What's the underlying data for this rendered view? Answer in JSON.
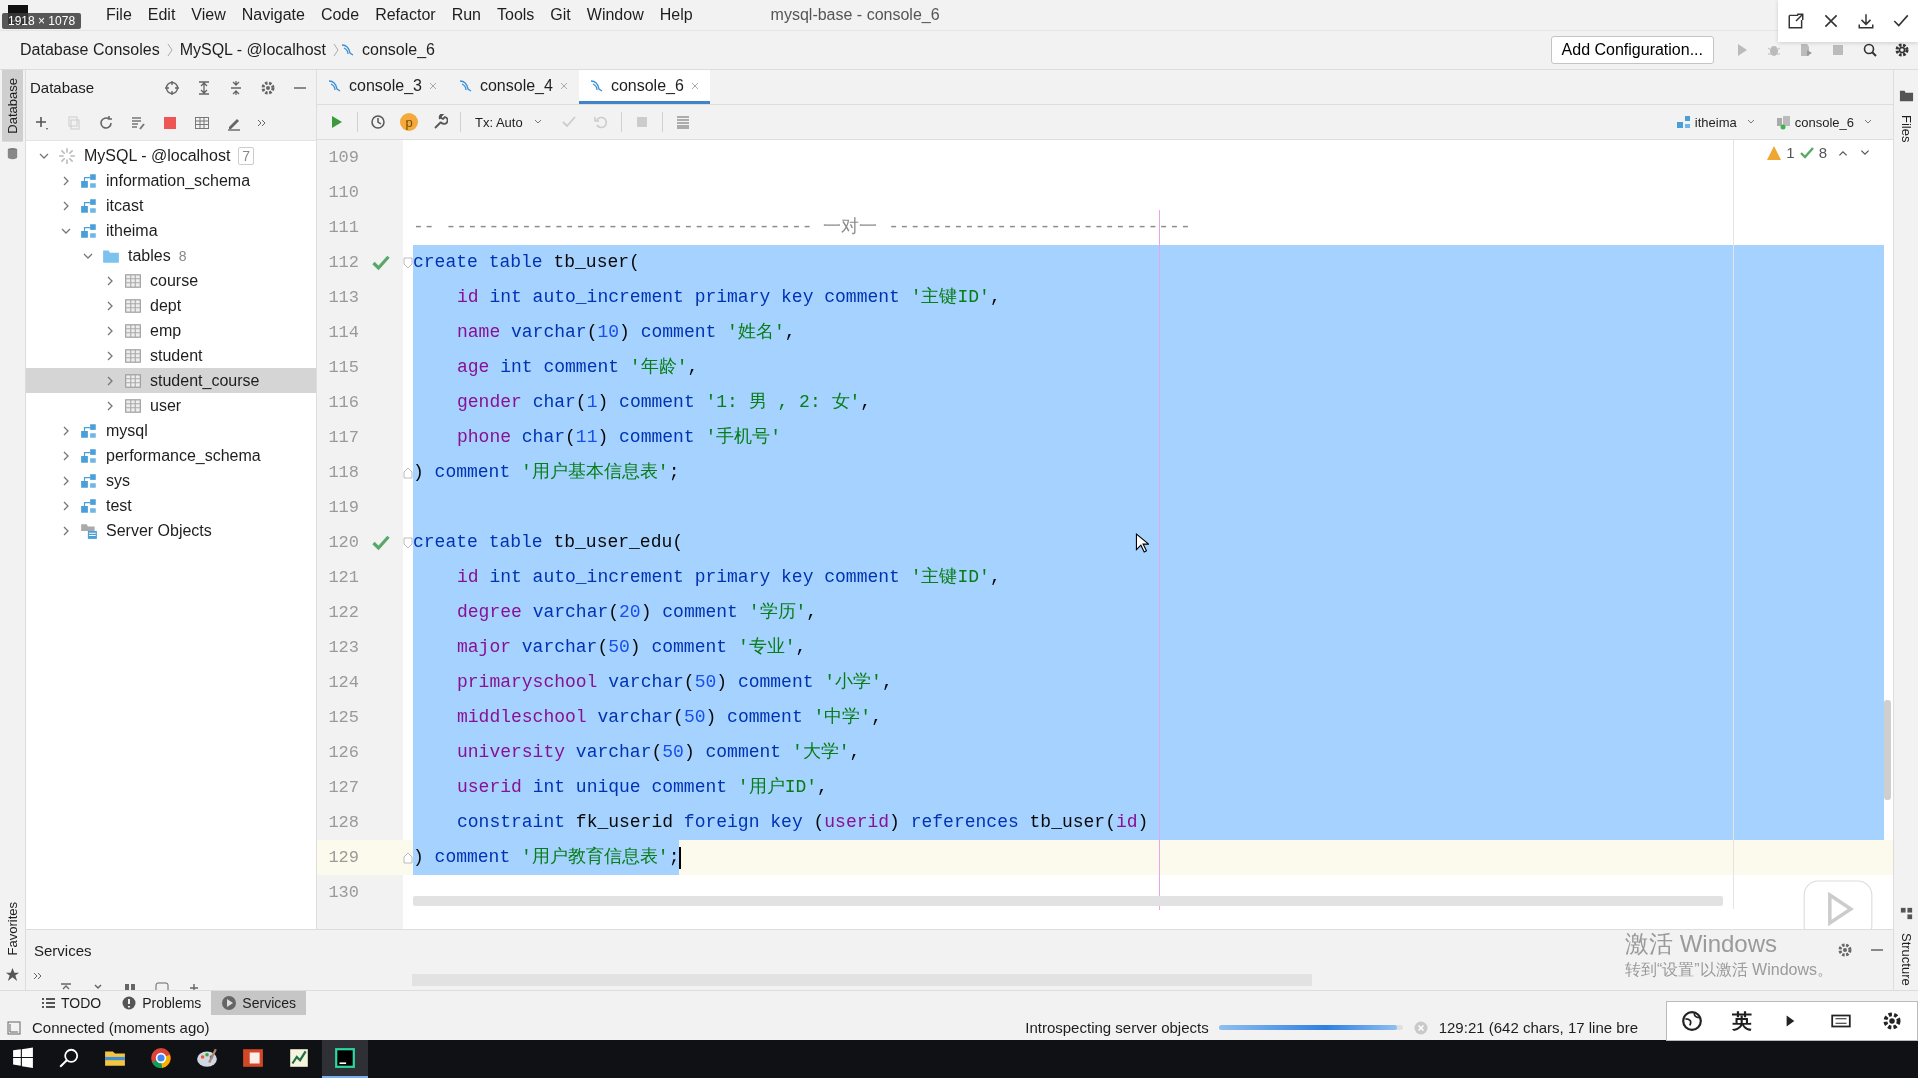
{
  "screen_size_label": "1918 × 1078",
  "menu": [
    "File",
    "Edit",
    "View",
    "Navigate",
    "Code",
    "Refactor",
    "Run",
    "Tools",
    "Git",
    "Window",
    "Help"
  ],
  "window_title": "mysql-base - console_6",
  "breadcrumbs": [
    {
      "label": "Database Consoles",
      "kind": "text"
    },
    {
      "label": "MySQL - @localhost",
      "kind": "text"
    },
    {
      "label": "console_6",
      "kind": "console"
    }
  ],
  "run_config": {
    "label": "Add Configuration..."
  },
  "side_tabs": {
    "left_top": "Database",
    "left_bottom": "Favorites",
    "right_top": "Files",
    "right_bottom": "Structure"
  },
  "database_panel": {
    "title": "Database"
  },
  "tree": [
    {
      "label": "MySQL - @localhost",
      "kind": "host",
      "count": "7",
      "expanded": true,
      "selected": false,
      "children": [
        {
          "label": "information_schema",
          "kind": "schema",
          "expanded": false,
          "selected": false
        },
        {
          "label": "itcast",
          "kind": "schema",
          "expanded": false,
          "selected": false
        },
        {
          "label": "itheima",
          "kind": "schema",
          "expanded": true,
          "selected": false,
          "children": [
            {
              "label": "tables",
              "kind": "folder",
              "count": "8",
              "expanded": true,
              "selected": false,
              "children": [
                {
                  "label": "course",
                  "kind": "table",
                  "expanded": false,
                  "selected": false
                },
                {
                  "label": "dept",
                  "kind": "table",
                  "expanded": false,
                  "selected": false
                },
                {
                  "label": "emp",
                  "kind": "table",
                  "expanded": false,
                  "selected": false
                },
                {
                  "label": "student",
                  "kind": "table",
                  "expanded": false,
                  "selected": false
                },
                {
                  "label": "student_course",
                  "kind": "table",
                  "expanded": false,
                  "selected": true
                },
                {
                  "label": "user",
                  "kind": "table",
                  "expanded": false,
                  "selected": false
                }
              ]
            }
          ]
        },
        {
          "label": "mysql",
          "kind": "schema",
          "expanded": false,
          "selected": false
        },
        {
          "label": "performance_schema",
          "kind": "schema",
          "expanded": false,
          "selected": false
        },
        {
          "label": "sys",
          "kind": "schema",
          "expanded": false,
          "selected": false
        },
        {
          "label": "test",
          "kind": "schema",
          "expanded": false,
          "selected": false
        },
        {
          "label": "Server Objects",
          "kind": "server",
          "expanded": false,
          "selected": false
        }
      ]
    }
  ],
  "editor_tabs": [
    {
      "label": "console_3",
      "selected": false
    },
    {
      "label": "console_4",
      "selected": false
    },
    {
      "label": "console_6",
      "selected": true
    }
  ],
  "profile_badge": "p",
  "tx_mode": "Tx: Auto",
  "schema_selector": "itheima",
  "session_selector": "console_6",
  "inspections": {
    "warnings": "1",
    "checks": "8"
  },
  "code_lines": [
    {
      "number": "109"
    },
    {
      "number": "110"
    },
    {
      "number": "111",
      "tokens": [
        {
          "t": "-- ---------------------------------- 一对一 ----------------------------",
          "kind": "comment"
        }
      ]
    },
    {
      "number": "112",
      "check": true,
      "fold_start": true,
      "selected": true,
      "tokens": [
        {
          "t": "create ",
          "kind": "keyword"
        },
        {
          "t": "table ",
          "kind": "keyword"
        },
        {
          "t": "tb_user(",
          "kind": "plain"
        }
      ]
    },
    {
      "number": "113",
      "indent": true,
      "selected": true,
      "tokens": [
        {
          "t": "id ",
          "kind": "field"
        },
        {
          "t": "int auto_increment primary key comment ",
          "kind": "keyword"
        },
        {
          "t": "'主键ID'",
          "kind": "string"
        },
        {
          "t": ",",
          "kind": "plain"
        }
      ]
    },
    {
      "number": "114",
      "indent": true,
      "selected": true,
      "tokens": [
        {
          "t": "name ",
          "kind": "field"
        },
        {
          "t": "varchar",
          "kind": "keyword"
        },
        {
          "t": "(",
          "kind": "plain"
        },
        {
          "t": "10",
          "kind": "number"
        },
        {
          "t": ") ",
          "kind": "plain"
        },
        {
          "t": "comment ",
          "kind": "keyword"
        },
        {
          "t": "'姓名'",
          "kind": "string"
        },
        {
          "t": ",",
          "kind": "plain"
        }
      ]
    },
    {
      "number": "115",
      "indent": true,
      "selected": true,
      "tokens": [
        {
          "t": "age ",
          "kind": "field"
        },
        {
          "t": "int comment ",
          "kind": "keyword"
        },
        {
          "t": "'年龄'",
          "kind": "string"
        },
        {
          "t": ",",
          "kind": "plain"
        }
      ]
    },
    {
      "number": "116",
      "indent": true,
      "selected": true,
      "tokens": [
        {
          "t": "gender ",
          "kind": "field"
        },
        {
          "t": "char",
          "kind": "keyword"
        },
        {
          "t": "(",
          "kind": "plain"
        },
        {
          "t": "1",
          "kind": "number"
        },
        {
          "t": ") ",
          "kind": "plain"
        },
        {
          "t": "comment ",
          "kind": "keyword"
        },
        {
          "t": "'1: 男 , 2: 女'",
          "kind": "string"
        },
        {
          "t": ",",
          "kind": "plain"
        }
      ]
    },
    {
      "number": "117",
      "indent": true,
      "selected": true,
      "tokens": [
        {
          "t": "phone ",
          "kind": "field"
        },
        {
          "t": "char",
          "kind": "keyword"
        },
        {
          "t": "(",
          "kind": "plain"
        },
        {
          "t": "11",
          "kind": "number"
        },
        {
          "t": ") ",
          "kind": "plain"
        },
        {
          "t": "comment ",
          "kind": "keyword"
        },
        {
          "t": "'手机号'",
          "kind": "string"
        }
      ]
    },
    {
      "number": "118",
      "fold_end": true,
      "selected": true,
      "tokens": [
        {
          "t": ") ",
          "kind": "plain"
        },
        {
          "t": "comment ",
          "kind": "keyword"
        },
        {
          "t": "'用户基本信息表'",
          "kind": "string"
        },
        {
          "t": ";",
          "kind": "plain"
        }
      ]
    },
    {
      "number": "119",
      "selected": true
    },
    {
      "number": "120",
      "check": true,
      "fold_start": true,
      "selected": true,
      "tokens": [
        {
          "t": "create ",
          "kind": "keyword"
        },
        {
          "t": "table ",
          "kind": "keyword"
        },
        {
          "t": "tb_user_edu(",
          "kind": "plain"
        }
      ]
    },
    {
      "number": "121",
      "indent": true,
      "selected": true,
      "tokens": [
        {
          "t": "id ",
          "kind": "field"
        },
        {
          "t": "int auto_increment primary key comment ",
          "kind": "keyword"
        },
        {
          "t": "'主键ID'",
          "kind": "string"
        },
        {
          "t": ",",
          "kind": "plain"
        }
      ]
    },
    {
      "number": "122",
      "indent": true,
      "selected": true,
      "tokens": [
        {
          "t": "degree ",
          "kind": "field"
        },
        {
          "t": "varchar",
          "kind": "keyword"
        },
        {
          "t": "(",
          "kind": "plain"
        },
        {
          "t": "20",
          "kind": "number"
        },
        {
          "t": ") ",
          "kind": "plain"
        },
        {
          "t": "comment ",
          "kind": "keyword"
        },
        {
          "t": "'学历'",
          "kind": "string"
        },
        {
          "t": ",",
          "kind": "plain"
        }
      ]
    },
    {
      "number": "123",
      "indent": true,
      "selected": true,
      "tokens": [
        {
          "t": "major ",
          "kind": "field"
        },
        {
          "t": "varchar",
          "kind": "keyword"
        },
        {
          "t": "(",
          "kind": "plain"
        },
        {
          "t": "50",
          "kind": "number"
        },
        {
          "t": ") ",
          "kind": "plain"
        },
        {
          "t": "comment ",
          "kind": "keyword"
        },
        {
          "t": "'专业'",
          "kind": "string"
        },
        {
          "t": ",",
          "kind": "plain"
        }
      ]
    },
    {
      "number": "124",
      "indent": true,
      "selected": true,
      "tokens": [
        {
          "t": "primaryschool ",
          "kind": "field"
        },
        {
          "t": "varchar",
          "kind": "keyword"
        },
        {
          "t": "(",
          "kind": "plain"
        },
        {
          "t": "50",
          "kind": "number"
        },
        {
          "t": ") ",
          "kind": "plain"
        },
        {
          "t": "comment ",
          "kind": "keyword"
        },
        {
          "t": "'小学'",
          "kind": "string"
        },
        {
          "t": ",",
          "kind": "plain"
        }
      ]
    },
    {
      "number": "125",
      "indent": true,
      "selected": true,
      "tokens": [
        {
          "t": "middleschool ",
          "kind": "field"
        },
        {
          "t": "varchar",
          "kind": "keyword"
        },
        {
          "t": "(",
          "kind": "plain"
        },
        {
          "t": "50",
          "kind": "number"
        },
        {
          "t": ") ",
          "kind": "plain"
        },
        {
          "t": "comment ",
          "kind": "keyword"
        },
        {
          "t": "'中学'",
          "kind": "string"
        },
        {
          "t": ",",
          "kind": "plain"
        }
      ]
    },
    {
      "number": "126",
      "indent": true,
      "selected": true,
      "tokens": [
        {
          "t": "university ",
          "kind": "field"
        },
        {
          "t": "varchar",
          "kind": "keyword"
        },
        {
          "t": "(",
          "kind": "plain"
        },
        {
          "t": "50",
          "kind": "number"
        },
        {
          "t": ") ",
          "kind": "plain"
        },
        {
          "t": "comment ",
          "kind": "keyword"
        },
        {
          "t": "'大学'",
          "kind": "string"
        },
        {
          "t": ",",
          "kind": "plain"
        }
      ]
    },
    {
      "number": "127",
      "indent": true,
      "selected": true,
      "tokens": [
        {
          "t": "userid ",
          "kind": "field"
        },
        {
          "t": "int unique comment ",
          "kind": "keyword"
        },
        {
          "t": "'用户ID'",
          "kind": "string"
        },
        {
          "t": ",",
          "kind": "plain"
        }
      ]
    },
    {
      "number": "128",
      "indent": true,
      "selected": true,
      "tokens": [
        {
          "t": "constraint ",
          "kind": "keyword"
        },
        {
          "t": "fk_userid ",
          "kind": "plain"
        },
        {
          "t": "foreign key ",
          "kind": "keyword"
        },
        {
          "t": "(",
          "kind": "plain"
        },
        {
          "t": "userid",
          "kind": "field"
        },
        {
          "t": ") ",
          "kind": "plain"
        },
        {
          "t": "references ",
          "kind": "keyword"
        },
        {
          "t": "tb_user(",
          "kind": "plain"
        },
        {
          "t": "id",
          "kind": "field"
        },
        {
          "t": ")",
          "kind": "plain"
        }
      ]
    },
    {
      "number": "129",
      "fold_end": true,
      "selected": true,
      "caret": true,
      "tokens": [
        {
          "t": ") ",
          "kind": "plain"
        },
        {
          "t": "comment ",
          "kind": "keyword"
        },
        {
          "t": "'用户教育信息表'",
          "kind": "string"
        },
        {
          "t": ";",
          "kind": "plain"
        }
      ]
    },
    {
      "number": "130"
    }
  ],
  "services": {
    "title": "Services"
  },
  "bottom_tabs": [
    {
      "label": "TODO",
      "kind": "todo",
      "selected": false
    },
    {
      "label": "Problems",
      "kind": "problems",
      "selected": false
    },
    {
      "label": "Services",
      "kind": "services",
      "selected": true
    }
  ],
  "status": {
    "message": "Connected (moments ago)",
    "task": "Introspecting server objects",
    "level": 0.97,
    "position": "129:21 (642 chars, 17 line bre"
  },
  "ime": {
    "label": "英"
  },
  "activation": {
    "title": "激活 Windows",
    "subtitle": "转到“设置”以激活 Windows。"
  },
  "taskbar": [
    {
      "kind": "start",
      "selected": false
    },
    {
      "kind": "search",
      "selected": false
    },
    {
      "kind": "files",
      "selected": false
    },
    {
      "kind": "browser",
      "selected": false
    },
    {
      "kind": "paint",
      "selected": false
    },
    {
      "kind": "slides",
      "selected": false
    },
    {
      "kind": "sheet",
      "selected": false
    },
    {
      "kind": "ide",
      "selected": true
    }
  ]
}
